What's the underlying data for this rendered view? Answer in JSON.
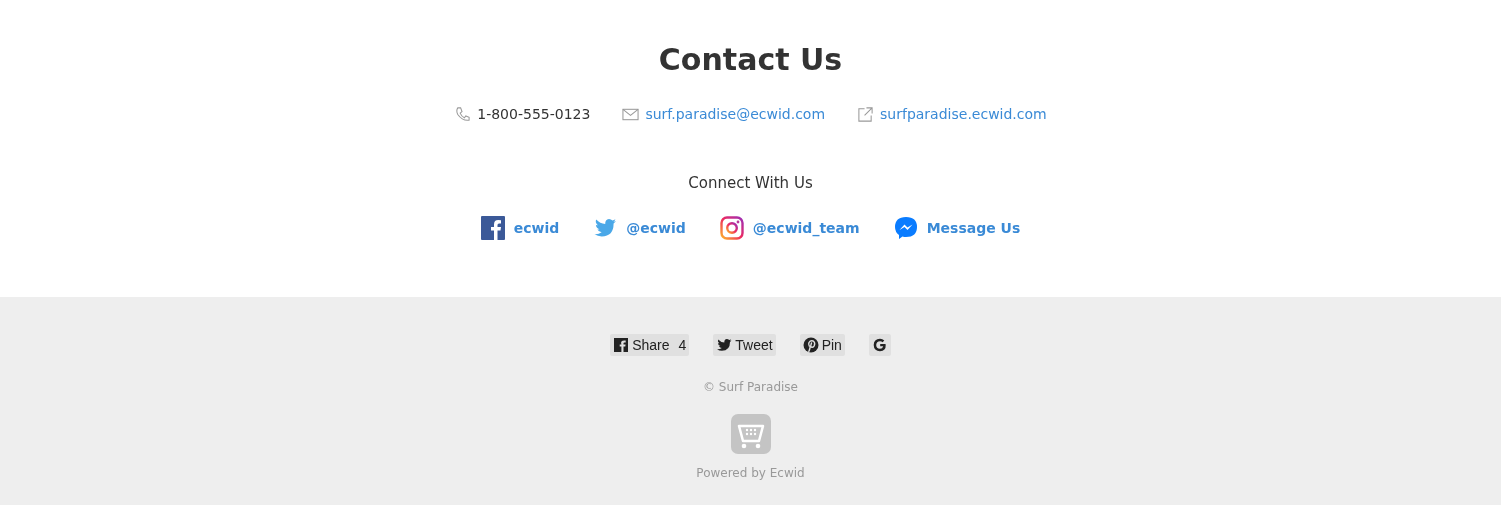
{
  "title": "Contact Us",
  "contacts": [
    {
      "kind": "phone",
      "text": "1-800-555-0123"
    },
    {
      "kind": "email",
      "text": "surf.paradise@ecwid.com"
    },
    {
      "kind": "website",
      "text": "surfparadise.ecwid.com"
    }
  ],
  "connect_heading": "Connect With Us",
  "social": [
    {
      "kind": "facebook",
      "text": "ecwid"
    },
    {
      "kind": "twitter",
      "text": "@ecwid"
    },
    {
      "kind": "instagram",
      "text": "@ecwid_team"
    },
    {
      "kind": "messenger",
      "text": "Message Us"
    }
  ],
  "share_buttons": [
    {
      "kind": "facebook",
      "label": "Share",
      "count": "4"
    },
    {
      "kind": "twitter",
      "label": "Tweet"
    },
    {
      "kind": "pinterest",
      "label": "Pin"
    },
    {
      "kind": "google"
    }
  ],
  "copyright": "© Surf Paradise",
  "powered_by": "Powered by Ecwid"
}
